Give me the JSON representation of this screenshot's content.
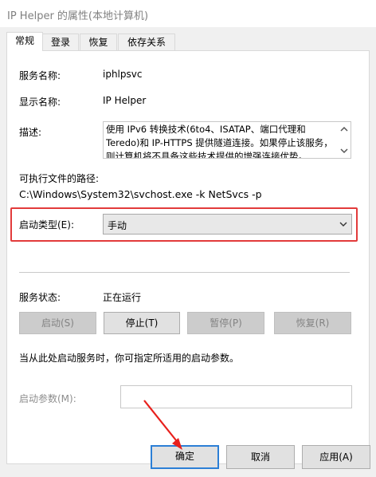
{
  "window": {
    "title": "IP Helper 的属性(本地计算机)"
  },
  "tabs": [
    {
      "label": "常规",
      "active": true
    },
    {
      "label": "登录",
      "active": false
    },
    {
      "label": "恢复",
      "active": false
    },
    {
      "label": "依存关系",
      "active": false
    }
  ],
  "general": {
    "service_name_label": "服务名称:",
    "service_name": "iphlpsvc",
    "display_name_label": "显示名称:",
    "display_name": "IP Helper",
    "description_label": "描述:",
    "description": "使用 IPv6 转换技术(6to4、ISATAP、端口代理和 Teredo)和 IP-HTTPS 提供隧道连接。如果停止该服务，则计算机将不具备这些技术提供的增强连接优势。",
    "exe_path_label": "可执行文件的路径:",
    "exe_path": "C:\\Windows\\System32\\svchost.exe -k NetSvcs -p",
    "startup_type_label": "启动类型(E):",
    "startup_type": "手动",
    "status_label": "服务状态:",
    "status": "正在运行",
    "buttons": {
      "start": "启动(S)",
      "stop": "停止(T)",
      "pause": "暂停(P)",
      "resume": "恢复(R)"
    },
    "hint": "当从此处启动服务时，你可指定所适用的启动参数。",
    "start_params_label": "启动参数(M):",
    "start_params_value": ""
  },
  "dialog_buttons": {
    "ok": "确定",
    "cancel": "取消",
    "apply": "应用(A)"
  },
  "colors": {
    "highlight_frame": "#e23b3b",
    "annotation_arrow": "#e8201c",
    "primary_focus": "#2c7fd6"
  }
}
